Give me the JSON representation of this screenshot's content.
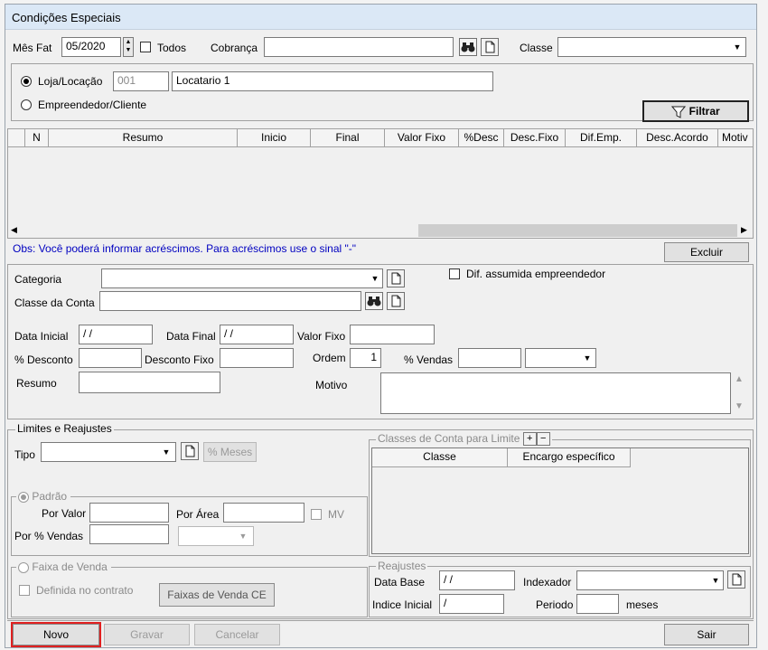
{
  "window": {
    "title": "Condições Especiais"
  },
  "filter": {
    "mes_fat_label": "Mês Fat",
    "mes_fat_value": "05/2020",
    "todos_label": "Todos",
    "cobranca_label": "Cobrança",
    "cobranca_value": "",
    "classe_label": "Classe",
    "classe_value": "",
    "loja_label": "Loja/Locação",
    "loja_code": "001",
    "loja_name": "Locatario 1",
    "empreendedor_label": "Empreendedor/Cliente",
    "filtrar_label": "Filtrar"
  },
  "grid": {
    "columns": [
      "N",
      "Resumo",
      "Inicio",
      "Final",
      "Valor Fixo",
      "%Desc",
      "Desc.Fixo",
      "Dif.Emp.",
      "Desc.Acordo",
      "Motiv"
    ],
    "rows": []
  },
  "obs": "Obs: Você poderá informar acréscimos. Para acréscimos use o sinal \"-\"",
  "excluir_label": "Excluir",
  "form": {
    "categoria_label": "Categoria",
    "dif_label": "Dif. assumida empreendedor",
    "classe_conta_label": "Classe da Conta",
    "data_inicial_label": "Data Inicial",
    "data_inicial_value": " / /",
    "data_final_label": "Data Final",
    "data_final_value": " / /",
    "valor_fixo_label": "Valor Fixo",
    "pct_desconto_label": "% Desconto",
    "desconto_fixo_label": "Desconto Fixo",
    "ordem_label": "Ordem",
    "ordem_value": "1",
    "pct_vendas_label": "% Vendas",
    "resumo_label": "Resumo",
    "motivo_label": "Motivo"
  },
  "limites": {
    "group_label": "Limites e Reajustes",
    "tipo_label": "Tipo",
    "meses_label": "% Meses",
    "padrao_label": "Padrão",
    "por_valor_label": "Por Valor",
    "por_area_label": "Por Área",
    "mv_label": "MV",
    "por_vendas_label": "Por % Vendas",
    "faixa_label": "Faixa de Venda",
    "definida_label": "Definida no contrato",
    "faixas_btn_label": "Faixas de Venda CE",
    "classes_group_label": "Classes de Conta para Limite",
    "classes_col_classe": "Classe",
    "classes_col_encargo": "Encargo específico",
    "reajustes_label": "Reajustes",
    "data_base_label": "Data Base",
    "data_base_value": " / /",
    "indexador_label": "Indexador",
    "indice_inicial_label": "Indice Inicial",
    "indice_inicial_value": " /",
    "periodo_label": "Periodo",
    "meses_suffix": "meses"
  },
  "footer": {
    "novo_label": "Novo",
    "gravar_label": "Gravar",
    "cancelar_label": "Cancelar",
    "sair_label": "Sair"
  }
}
